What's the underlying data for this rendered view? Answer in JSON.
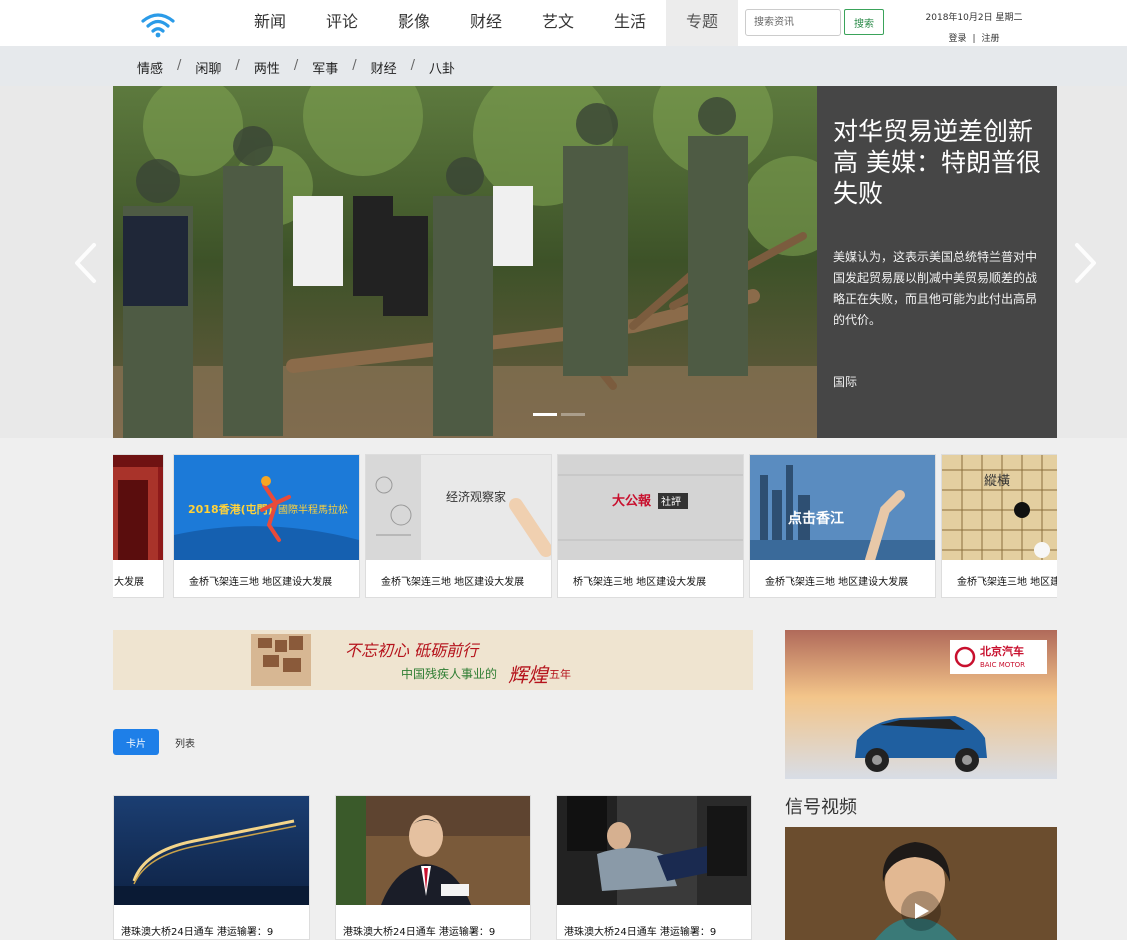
{
  "header": {
    "nav": [
      "新闻",
      "评论",
      "影像",
      "财经",
      "艺文",
      "生活",
      "专题"
    ],
    "active_nav": "专题",
    "search_placeholder": "搜索资讯",
    "search_button": "搜索",
    "date": "2018年10月2日 星期二",
    "login": "登录",
    "separator": "|",
    "register": "注册"
  },
  "subnav": [
    "情感",
    "闲聊",
    "两性",
    "军事",
    "财经",
    "八卦"
  ],
  "subnav_separator": "/",
  "hero": {
    "title": "对华贸易逆差创新高 美媒：特朗普很失败",
    "description": "美媒认为，这表示美国总统特兰普对中国发起贸易展以削减中美贸易顺差的战略正在失败，而且他可能为此付出高昂的代价。",
    "category": "国际",
    "slide_count": 2,
    "active_slide": 1
  },
  "strip": {
    "items": [
      {
        "caption": "大发展",
        "image": "red-building"
      },
      {
        "caption": "金桥飞架连三地 地区建设大发展",
        "image": "marathon-poster",
        "poster_year": "2018香港(屯門)",
        "poster_title": "國際半程馬拉松"
      },
      {
        "caption": "金桥飞架连三地 地区建设大发展",
        "image": "economist-sketch",
        "sketch_text": "经济观察家"
      },
      {
        "caption": "桥飞架连三地 地区建设大发展",
        "image": "takungpao-logo",
        "logo_text": "大公報",
        "logo_tag": "社評"
      },
      {
        "caption": "金桥飞架连三地 地区建设大发展",
        "image": "hk-skyline",
        "overlay_text": "点击香江"
      },
      {
        "caption": "金桥飞架连三地 地区建设大发展",
        "image": "go-board",
        "board_text": "縱橫"
      }
    ]
  },
  "banner": {
    "slogan": "不忘初心 砥砺前行",
    "subtitle": "中国残疾人事业的",
    "highlight": "辉煌",
    "suffix": "五年"
  },
  "ad": {
    "brand": "北京汽车",
    "brand_en": "BAIC MOTOR"
  },
  "view_toggle": {
    "card": "卡片",
    "list": "列表"
  },
  "video_section": {
    "heading": "信号视频"
  },
  "news_cards": [
    {
      "caption": "港珠澳大桥24日通车 港运输署：9",
      "image": "bridge-night"
    },
    {
      "caption": "港珠澳大桥24日通车 港运输署：9",
      "image": "official-portrait"
    },
    {
      "caption": "港珠澳大桥24日通车 港运输署：9",
      "image": "crowd-scuffle"
    }
  ],
  "colors": {
    "accent_blue": "#1e7fe8",
    "search_green": "#2a8a48",
    "hero_panel": "#464646",
    "logo_blue": "#2b9be8"
  },
  "icons": {
    "logo": "wifi-icon",
    "prev": "chevron-left-icon",
    "next": "chevron-right-icon",
    "play": "play-icon"
  }
}
